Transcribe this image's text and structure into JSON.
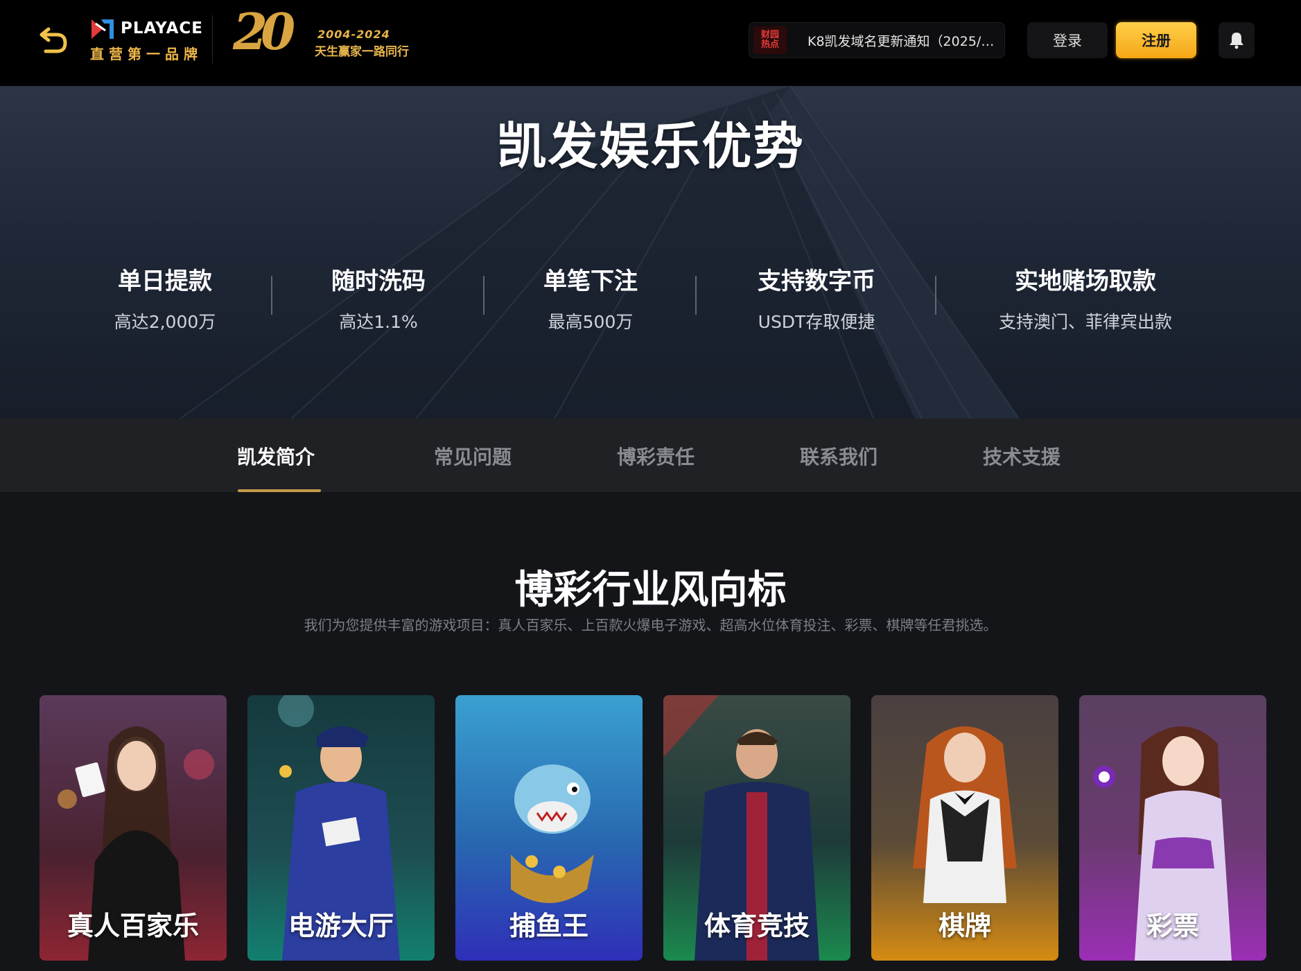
{
  "header": {
    "brand_name": "PLAYACE",
    "brand_tagline": "直营第一品牌",
    "anniversary_number": "20",
    "anniversary_years": "2004-2024",
    "anniversary_slogan": "天生赢家一路同行",
    "notice_badge_line1": "财园",
    "notice_badge_line2": "热点",
    "notice_text": "K8凯发域名更新通知（2025/0...",
    "login_label": "登录",
    "register_label": "注册"
  },
  "hero": {
    "title": "凯发娱乐优势",
    "stats": [
      {
        "title": "单日提款",
        "sub": "高达2,000万"
      },
      {
        "title": "随时洗码",
        "sub": "高达1.1%"
      },
      {
        "title": "单笔下注",
        "sub": "最高500万"
      },
      {
        "title": "支持数字币",
        "sub": "USDT存取便捷"
      },
      {
        "title": "实地赌场取款",
        "sub": "支持澳门、菲律宾出款"
      }
    ]
  },
  "tabs": [
    {
      "label": "凯发简介",
      "active": true
    },
    {
      "label": "常见问题",
      "active": false
    },
    {
      "label": "博彩责任",
      "active": false
    },
    {
      "label": "联系我们",
      "active": false
    },
    {
      "label": "技术支援",
      "active": false
    }
  ],
  "section": {
    "title": "博彩行业风向标",
    "description": "我们为您提供丰富的游戏项目：真人百家乐、上百款火爆电子游戏、超高水位体育投注、彩票、棋牌等任君挑选。"
  },
  "cards": [
    {
      "label": "真人百家乐",
      "color_top": "#6b3a4a",
      "color_bottom": "#8e2533"
    },
    {
      "label": "电游大厅",
      "color_top": "#1f5a5e",
      "color_bottom": "#137a6e"
    },
    {
      "label": "捕鱼王",
      "color_top": "#2e8fb8",
      "color_bottom": "#2f2fb8"
    },
    {
      "label": "体育竞技",
      "color_top": "#2e4a40",
      "color_bottom": "#1b8a4e"
    },
    {
      "label": "棋牌",
      "color_top": "#5a4a3a",
      "color_bottom": "#d58b12"
    },
    {
      "label": "彩票",
      "color_top": "#5e3a6a",
      "color_bottom": "#9b2fb5"
    }
  ],
  "colors": {
    "accent_gold": "#f5a615",
    "tab_underline": "#c79a4a"
  },
  "icons": {
    "back": "back-arrow-icon",
    "bell": "bell-icon"
  }
}
